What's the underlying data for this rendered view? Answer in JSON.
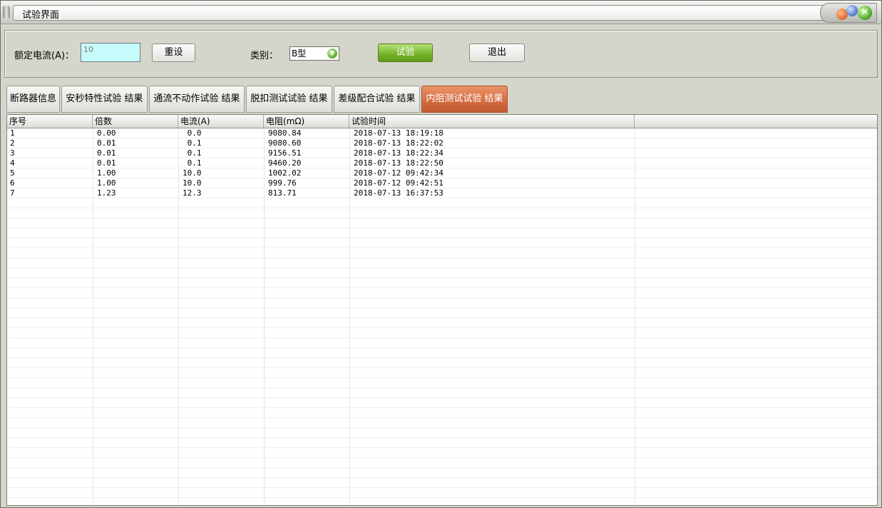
{
  "window": {
    "title": "试验界面"
  },
  "form": {
    "rated_current_label": "额定电流(A)：",
    "rated_current_value": "10",
    "reset_label": "重设",
    "category_label": "类别：",
    "category_value": "B型",
    "test_label": "试验",
    "exit_label": "退出"
  },
  "tabs": [
    {
      "label": "断路器信息",
      "active": false
    },
    {
      "label": "安秒特性试验 结果",
      "active": false
    },
    {
      "label": "通流不动作试验 结果",
      "active": false
    },
    {
      "label": "脱扣测试试验 结果",
      "active": false
    },
    {
      "label": "差级配合试验 结果",
      "active": false
    },
    {
      "label": "内阻测试试验 结果",
      "active": true
    }
  ],
  "table": {
    "columns": [
      "序号",
      "倍数",
      "电流(A)",
      "电阻(mΩ)",
      "试验时间",
      ""
    ],
    "rows": [
      [
        "1",
        "0.00",
        " 0.0",
        "9080.84",
        "2018-07-13 18:19:18"
      ],
      [
        "2",
        "0.01",
        " 0.1",
        "9080.60",
        "2018-07-13 18:22:02"
      ],
      [
        "3",
        "0.01",
        " 0.1",
        "9156.51",
        "2018-07-13 18:22:34"
      ],
      [
        "4",
        "0.01",
        " 0.1",
        "9460.20",
        "2018-07-13 18:22:50"
      ],
      [
        "5",
        "1.00",
        "10.0",
        "1002.02",
        "2018-07-12 09:42:34"
      ],
      [
        "6",
        "1.00",
        "10.0",
        "999.76",
        "2018-07-12 09:42:51"
      ],
      [
        "7",
        "1.23",
        "12.3",
        "813.71",
        "2018-07-13 16:37:53"
      ]
    ]
  },
  "colors": {
    "input_bg": "#c6fbfb",
    "active_tab": "#d26a3f",
    "test_button": "#74b229"
  }
}
